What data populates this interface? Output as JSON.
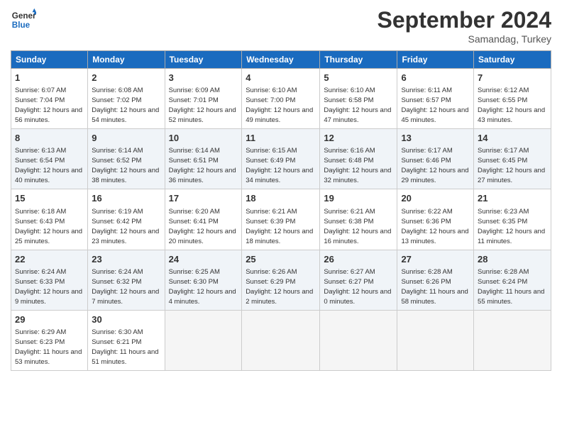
{
  "header": {
    "logo_line1": "General",
    "logo_line2": "Blue",
    "month_title": "September 2024",
    "subtitle": "Samandag, Turkey"
  },
  "weekdays": [
    "Sunday",
    "Monday",
    "Tuesday",
    "Wednesday",
    "Thursday",
    "Friday",
    "Saturday"
  ],
  "weeks": [
    [
      {
        "day": "1",
        "sunrise": "6:07 AM",
        "sunset": "7:04 PM",
        "daylight": "12 hours and 56 minutes."
      },
      {
        "day": "2",
        "sunrise": "6:08 AM",
        "sunset": "7:02 PM",
        "daylight": "12 hours and 54 minutes."
      },
      {
        "day": "3",
        "sunrise": "6:09 AM",
        "sunset": "7:01 PM",
        "daylight": "12 hours and 52 minutes."
      },
      {
        "day": "4",
        "sunrise": "6:10 AM",
        "sunset": "7:00 PM",
        "daylight": "12 hours and 49 minutes."
      },
      {
        "day": "5",
        "sunrise": "6:10 AM",
        "sunset": "6:58 PM",
        "daylight": "12 hours and 47 minutes."
      },
      {
        "day": "6",
        "sunrise": "6:11 AM",
        "sunset": "6:57 PM",
        "daylight": "12 hours and 45 minutes."
      },
      {
        "day": "7",
        "sunrise": "6:12 AM",
        "sunset": "6:55 PM",
        "daylight": "12 hours and 43 minutes."
      }
    ],
    [
      {
        "day": "8",
        "sunrise": "6:13 AM",
        "sunset": "6:54 PM",
        "daylight": "12 hours and 40 minutes."
      },
      {
        "day": "9",
        "sunrise": "6:14 AM",
        "sunset": "6:52 PM",
        "daylight": "12 hours and 38 minutes."
      },
      {
        "day": "10",
        "sunrise": "6:14 AM",
        "sunset": "6:51 PM",
        "daylight": "12 hours and 36 minutes."
      },
      {
        "day": "11",
        "sunrise": "6:15 AM",
        "sunset": "6:49 PM",
        "daylight": "12 hours and 34 minutes."
      },
      {
        "day": "12",
        "sunrise": "6:16 AM",
        "sunset": "6:48 PM",
        "daylight": "12 hours and 32 minutes."
      },
      {
        "day": "13",
        "sunrise": "6:17 AM",
        "sunset": "6:46 PM",
        "daylight": "12 hours and 29 minutes."
      },
      {
        "day": "14",
        "sunrise": "6:17 AM",
        "sunset": "6:45 PM",
        "daylight": "12 hours and 27 minutes."
      }
    ],
    [
      {
        "day": "15",
        "sunrise": "6:18 AM",
        "sunset": "6:43 PM",
        "daylight": "12 hours and 25 minutes."
      },
      {
        "day": "16",
        "sunrise": "6:19 AM",
        "sunset": "6:42 PM",
        "daylight": "12 hours and 23 minutes."
      },
      {
        "day": "17",
        "sunrise": "6:20 AM",
        "sunset": "6:41 PM",
        "daylight": "12 hours and 20 minutes."
      },
      {
        "day": "18",
        "sunrise": "6:21 AM",
        "sunset": "6:39 PM",
        "daylight": "12 hours and 18 minutes."
      },
      {
        "day": "19",
        "sunrise": "6:21 AM",
        "sunset": "6:38 PM",
        "daylight": "12 hours and 16 minutes."
      },
      {
        "day": "20",
        "sunrise": "6:22 AM",
        "sunset": "6:36 PM",
        "daylight": "12 hours and 13 minutes."
      },
      {
        "day": "21",
        "sunrise": "6:23 AM",
        "sunset": "6:35 PM",
        "daylight": "12 hours and 11 minutes."
      }
    ],
    [
      {
        "day": "22",
        "sunrise": "6:24 AM",
        "sunset": "6:33 PM",
        "daylight": "12 hours and 9 minutes."
      },
      {
        "day": "23",
        "sunrise": "6:24 AM",
        "sunset": "6:32 PM",
        "daylight": "12 hours and 7 minutes."
      },
      {
        "day": "24",
        "sunrise": "6:25 AM",
        "sunset": "6:30 PM",
        "daylight": "12 hours and 4 minutes."
      },
      {
        "day": "25",
        "sunrise": "6:26 AM",
        "sunset": "6:29 PM",
        "daylight": "12 hours and 2 minutes."
      },
      {
        "day": "26",
        "sunrise": "6:27 AM",
        "sunset": "6:27 PM",
        "daylight": "12 hours and 0 minutes."
      },
      {
        "day": "27",
        "sunrise": "6:28 AM",
        "sunset": "6:26 PM",
        "daylight": "11 hours and 58 minutes."
      },
      {
        "day": "28",
        "sunrise": "6:28 AM",
        "sunset": "6:24 PM",
        "daylight": "11 hours and 55 minutes."
      }
    ],
    [
      {
        "day": "29",
        "sunrise": "6:29 AM",
        "sunset": "6:23 PM",
        "daylight": "11 hours and 53 minutes."
      },
      {
        "day": "30",
        "sunrise": "6:30 AM",
        "sunset": "6:21 PM",
        "daylight": "11 hours and 51 minutes."
      },
      null,
      null,
      null,
      null,
      null
    ]
  ]
}
